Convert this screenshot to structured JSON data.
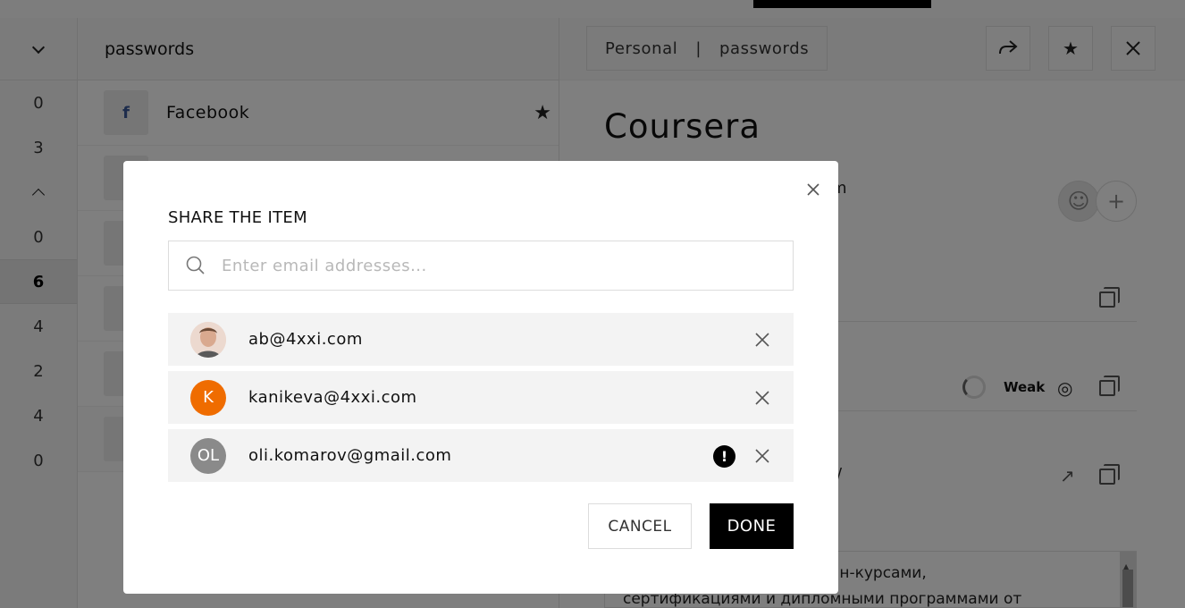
{
  "app": {
    "left_column": {
      "counts": [
        "0",
        "3",
        "0",
        "6",
        "4",
        "2",
        "4",
        "0"
      ],
      "active_index": 3
    },
    "list": {
      "header_title": "passwords",
      "entries": [
        {
          "name": "Facebook",
          "logo": "f",
          "starred": true
        },
        {
          "name": "",
          "logo": ""
        },
        {
          "name": "",
          "logo": ""
        },
        {
          "name": "",
          "logo": ""
        },
        {
          "name": "",
          "logo": ""
        },
        {
          "name": "",
          "logo": ""
        }
      ]
    },
    "detail": {
      "breadcrumb_vault": "Personal",
      "breadcrumb_sep": "|",
      "breadcrumb_folder": "passwords",
      "title": "Coursera",
      "login_fragment": "m",
      "url_fragment": "/",
      "strength_label": "Weak",
      "notes_line1": "лайн-курсами,",
      "notes_line2": "сертификациями и дипломными программами от"
    }
  },
  "modal": {
    "title": "SHARE THE ITEM",
    "search_placeholder": "Enter email addresses...",
    "search_value": "",
    "recipients": [
      {
        "email": "ab@4xxi.com",
        "initials": "",
        "avatar_type": "photo",
        "warning": false
      },
      {
        "email": "kanikeva@4xxi.com",
        "initials": "K",
        "avatar_color": "#ef6c00",
        "warning": false
      },
      {
        "email": "oli.komarov@gmail.com",
        "initials": "OL",
        "avatar_color": "#8a8a8a",
        "warning": true,
        "warning_symbol": "!"
      }
    ],
    "cancel_label": "CANCEL",
    "done_label": "DONE"
  }
}
